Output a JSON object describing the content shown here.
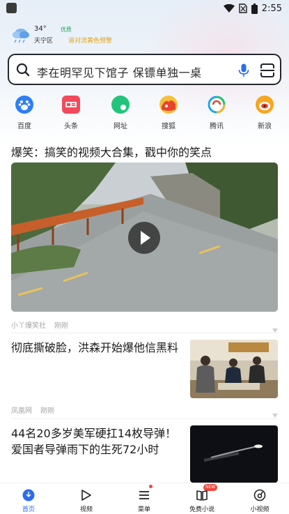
{
  "status_bar": {
    "time": "2:55",
    "app_icon": "square-app-icon",
    "wifi_icon": "wifi-icon",
    "sim_icon": "no-sim-icon",
    "battery_icon": "battery-icon"
  },
  "weather": {
    "temperature": "34°",
    "air_quality": "优质",
    "district": "天宁区",
    "warning": "道对流黄色预警",
    "icon": "cloud-weather-icon",
    "quality_color": "#21a65a",
    "warning_color": "#e0a419"
  },
  "search": {
    "text": "李在明罕见下馆子 保镖单独一桌",
    "search_icon": "search-icon",
    "mic_icon": "mic-icon",
    "scan_icon": "scan-icon"
  },
  "shortcuts": [
    {
      "label": "百度",
      "icon": "baidu-icon",
      "color": "#2f7ef3"
    },
    {
      "label": "头条",
      "icon": "toutiao-icon",
      "color": "#f24a5d"
    },
    {
      "label": "网址",
      "icon": "url-icon",
      "color": "#21c47a"
    },
    {
      "label": "搜狐",
      "icon": "sohu-icon",
      "color": "#f26a1f"
    },
    {
      "label": "腾讯",
      "icon": "tencent-icon",
      "color": "#1aa6e8"
    },
    {
      "label": "新浪",
      "icon": "sina-icon",
      "color": "#f5a623"
    }
  ],
  "feed": {
    "top_headline": "爆笑：搞笑的视频大合集，戳中你的笑点",
    "video": {
      "source": "小丫爆笑社",
      "time": "刚刚",
      "icon": "play-icon"
    },
    "articles": [
      {
        "title_lines": [
          "彻底撕破脸，洪森开始爆他信黑料"
        ],
        "source": "凤凰网",
        "time": "刚刚"
      },
      {
        "title_lines": [
          "44名20多岁美军硬扛14枚导弹！",
          "爱国者导弹雨下的生死72小时"
        ],
        "source": "",
        "time": ""
      }
    ]
  },
  "bottom_nav": [
    {
      "label": "首页",
      "icon": "home-icon",
      "active": true
    },
    {
      "label": "视频",
      "icon": "video-icon",
      "active": false
    },
    {
      "label": "菜单",
      "icon": "menu-icon",
      "active": false,
      "dot": true
    },
    {
      "label": "免费小说",
      "icon": "book-icon",
      "active": false,
      "badge": "NEW"
    },
    {
      "label": "小视频",
      "icon": "short-video-icon",
      "active": false
    }
  ],
  "colors": {
    "accent": "#2a6cf0",
    "badge": "#f0443c"
  }
}
